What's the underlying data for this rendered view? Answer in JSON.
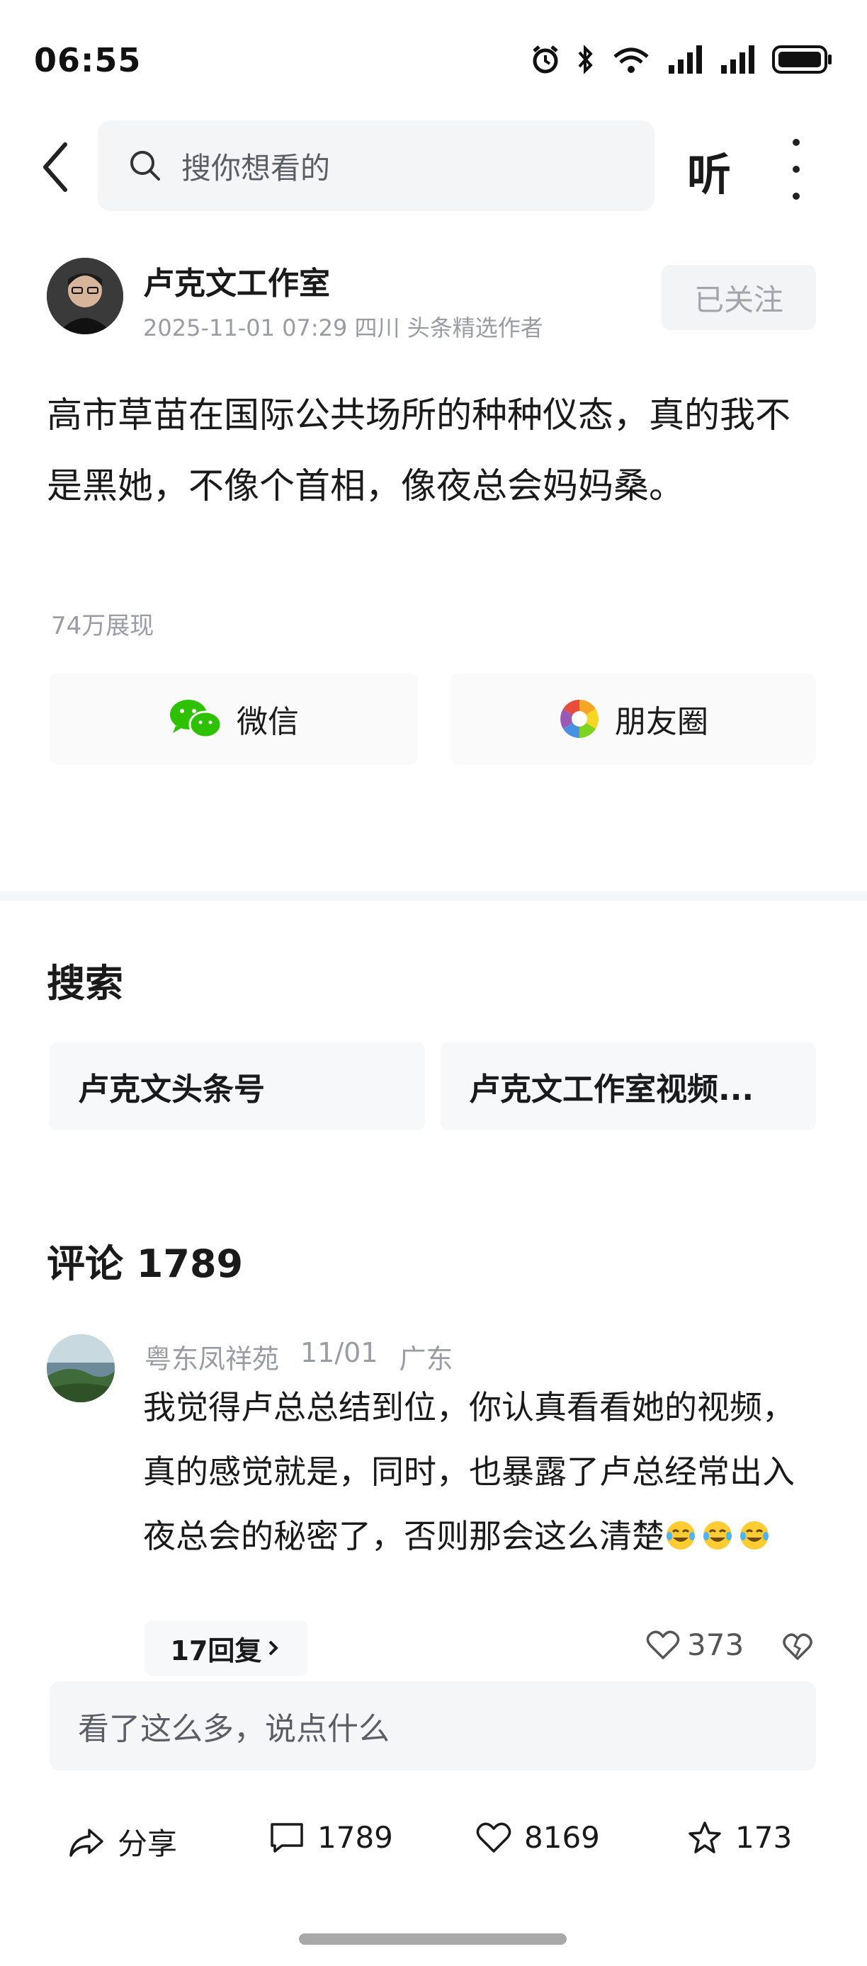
{
  "status_bar": {
    "time": "06:55",
    "icons": [
      "alarm-icon",
      "bluetooth-icon",
      "wifi-6-icon",
      "signal-icon",
      "signal-icon",
      "battery-icon"
    ]
  },
  "top_bar": {
    "search_placeholder": "搜你想看的",
    "listen_label": "听"
  },
  "author": {
    "name": "卢克文工作室",
    "meta": "2025-11-01 07:29 四川 头条精选作者",
    "follow_label": "已关注"
  },
  "post": {
    "text": "高市草苗在国际公共场所的种种仪态，真的我不是黑她，不像个首相，像夜总会妈妈桑。",
    "views": "74万展现"
  },
  "share": {
    "wechat_label": "微信",
    "moments_label": "朋友圈"
  },
  "search_section": {
    "title": "搜索",
    "items": [
      "卢克文头条号",
      "卢克文工作室视频..."
    ]
  },
  "comments": {
    "title": "评论 1789",
    "items": [
      {
        "user": "粤东凤祥苑",
        "date": "11/01",
        "location": "广东",
        "text": "我觉得卢总总结到位，你认真看看她的视频，真的感觉就是，同时，也暴露了卢总经常出入夜总会的秘密了，否则那会这么清楚",
        "replies_label": "17回复",
        "likes": "373"
      }
    ]
  },
  "comment_input": {
    "placeholder": "看了这么多，说点什么"
  },
  "bottom_bar": {
    "share_label": "分享",
    "comments_count": "1789",
    "likes_count": "8169",
    "favorites_count": "173"
  },
  "colors": {
    "accent_gray": "#9a9ca3",
    "chip_bg": "#f7f8fa",
    "wechat_green": "#2dc100"
  }
}
